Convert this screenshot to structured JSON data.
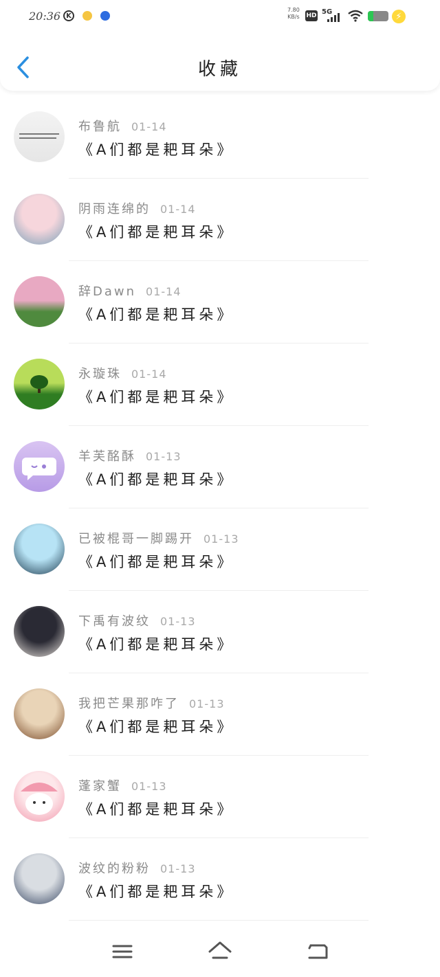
{
  "status_bar": {
    "time": "20:36",
    "k_badge": "K",
    "net_speed_value": "7.80",
    "net_speed_unit": "KB/s",
    "hd_label": "HD",
    "network_label": "5G"
  },
  "header": {
    "title": "收藏"
  },
  "favorites": [
    {
      "user": "布鲁航",
      "date": "01-14",
      "title": "《A们都是耙耳朵》",
      "avatar_colors": [
        "#f3f3f3",
        "#e6e6e6"
      ],
      "avatar_kind": "text-note"
    },
    {
      "user": "阴雨连绵的",
      "date": "01-14",
      "title": "《A们都是耙耳朵》",
      "avatar_colors": [
        "#f6d6dc",
        "#7aa0b8"
      ],
      "avatar_kind": "portrait"
    },
    {
      "user": "辞Dawn",
      "date": "01-14",
      "title": "《A们都是耙耳朵》",
      "avatar_colors": [
        "#e8a9c2",
        "#4f8a3e"
      ],
      "avatar_kind": "scenery"
    },
    {
      "user": "永璇珠",
      "date": "01-14",
      "title": "《A们都是耙耳朵》",
      "avatar_colors": [
        "#b8dc5a",
        "#2f7d22"
      ],
      "avatar_kind": "tree"
    },
    {
      "user": "羊芙酩酥",
      "date": "01-13",
      "title": "《A们都是耙耳朵》",
      "avatar_colors": [
        "#d9c4f2",
        "#b79be6"
      ],
      "avatar_kind": "chat-bubble"
    },
    {
      "user": "已被棍哥一脚踢开",
      "date": "01-13",
      "title": "《A们都是耙耳朵》",
      "avatar_colors": [
        "#b7e3f5",
        "#1d3b4f"
      ],
      "avatar_kind": "portrait"
    },
    {
      "user": "下禹有波纹",
      "date": "01-13",
      "title": "《A们都是耙耳朵》",
      "avatar_colors": [
        "#2a2a34",
        "#e9e3dd"
      ],
      "avatar_kind": "portrait"
    },
    {
      "user": "我把芒果那咋了",
      "date": "01-13",
      "title": "《A们都是耙耳朵》",
      "avatar_colors": [
        "#e9d4b7",
        "#7a4b2a"
      ],
      "avatar_kind": "portrait"
    },
    {
      "user": "蓬家蟹",
      "date": "01-13",
      "title": "《A们都是耙耳朵》",
      "avatar_colors": [
        "#fde7ea",
        "#f29aae"
      ],
      "avatar_kind": "cartoon-bear"
    },
    {
      "user": "波纹的粉粉",
      "date": "01-13",
      "title": "《A们都是耙耳朵》",
      "avatar_colors": [
        "#d9dde2",
        "#3b4a66"
      ],
      "avatar_kind": "portrait"
    }
  ],
  "colors": {
    "accent": "#2b8fe0",
    "title_text": "#222222",
    "meta_text": "#8a8a8a"
  },
  "bottom_nav": {
    "menu_icon": "menu-icon",
    "home_icon": "home-icon",
    "back_icon": "return-icon"
  }
}
